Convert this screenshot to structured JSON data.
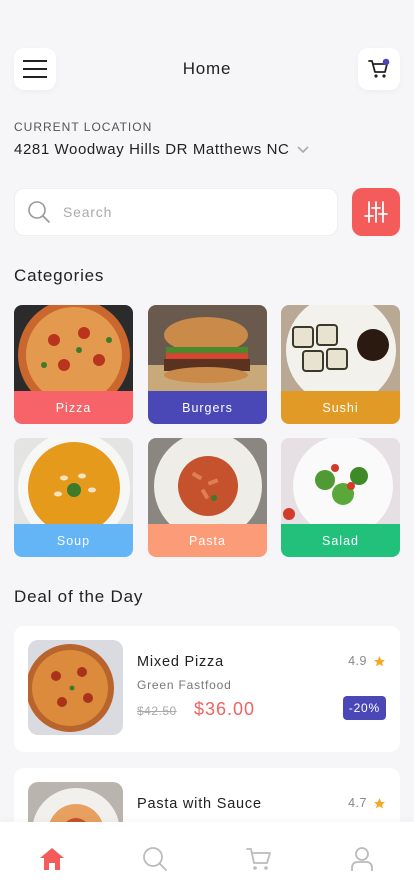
{
  "header": {
    "title": "Home",
    "menu_icon": "hamburger-menu-icon",
    "cart_icon": "cart-icon",
    "cart_badge_color": "#4a48b6"
  },
  "location": {
    "label": "CURRENT LOCATION",
    "value": "4281 Woodway Hills DR Matthews NC"
  },
  "search": {
    "placeholder": "Search",
    "value": ""
  },
  "filter": {
    "icon": "sliders-icon",
    "color": "#f45b5b"
  },
  "categories": {
    "title": "Categories",
    "items": [
      {
        "label": "Pizza",
        "color": "#f66368"
      },
      {
        "label": "Burgers",
        "color": "#4a48b6"
      },
      {
        "label": "Sushi",
        "color": "#e29a26"
      },
      {
        "label": "Soup",
        "color": "#64b5f6"
      },
      {
        "label": "Pasta",
        "color": "#fb9b78"
      },
      {
        "label": "Salad",
        "color": "#22c17b"
      }
    ]
  },
  "deals": {
    "title": "Deal of the Day",
    "items": [
      {
        "name": "Mixed Pizza",
        "subtitle": "Green Fastfood",
        "old_price": "$42.50",
        "price": "$36.00",
        "rating": "4.9",
        "badge": "-20%"
      },
      {
        "name": "Pasta with Sauce",
        "rating": "4.7"
      }
    ]
  },
  "bottom_nav": [
    {
      "icon": "home-icon",
      "active": true
    },
    {
      "icon": "search-icon",
      "active": false
    },
    {
      "icon": "cart-icon",
      "active": false
    },
    {
      "icon": "profile-icon",
      "active": false
    }
  ],
  "colors": {
    "accent": "#f45b5b",
    "price": "#f26262",
    "star": "#f5a623",
    "badge": "#4a48b6"
  }
}
